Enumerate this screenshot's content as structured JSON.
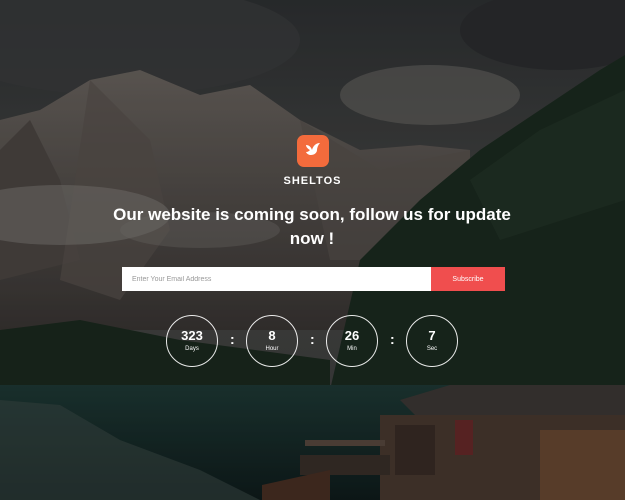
{
  "brand": {
    "name": "SHELTOS",
    "accent": "#f36b3c",
    "logo_icon": "bird-icon"
  },
  "hero": {
    "headline": "Our website is coming soon, follow us for update now !"
  },
  "signup": {
    "placeholder": "Enter Your Email Address",
    "button_label": "Subscribe",
    "button_color": "#f04e4e"
  },
  "countdown": {
    "separator": ":",
    "items": [
      {
        "value": "323",
        "unit": "Days"
      },
      {
        "value": "8",
        "unit": "Hour"
      },
      {
        "value": "26",
        "unit": "Min"
      },
      {
        "value": "7",
        "unit": "Sec"
      }
    ]
  }
}
